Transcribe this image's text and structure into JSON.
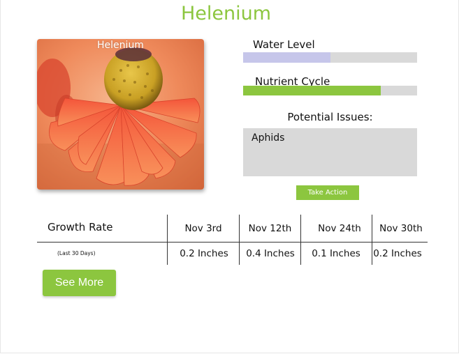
{
  "header": {
    "title": "Helenium"
  },
  "plant_card": {
    "label": "Helenium",
    "image": "helenium-flower-photo"
  },
  "water_level": {
    "label": "Water Level",
    "level": 0.5,
    "color": "#c6c6ea"
  },
  "nutrient_cycle": {
    "label": "Nutrient Cycle",
    "level": 0.79,
    "color": "#8cc63f"
  },
  "potential_issues": {
    "heading": "Potential Issues:",
    "items": [
      "Aphids"
    ],
    "action_label": "Take Action"
  },
  "growth": {
    "label": "Growth Rate",
    "sublabel": "(Last 30 Days)",
    "columns": [
      {
        "date": "Nov 3rd",
        "value": "0.2 Inches"
      },
      {
        "date": "Nov 12th",
        "value": "0.4 Inches"
      },
      {
        "date": "Nov 24th",
        "value": "0.1 Inches"
      },
      {
        "date": "Nov 30th",
        "value": "0.2 Inches"
      }
    ]
  },
  "see_more_label": "See More",
  "colors": {
    "accent": "#8cc63f",
    "track": "#d9d9d9"
  }
}
